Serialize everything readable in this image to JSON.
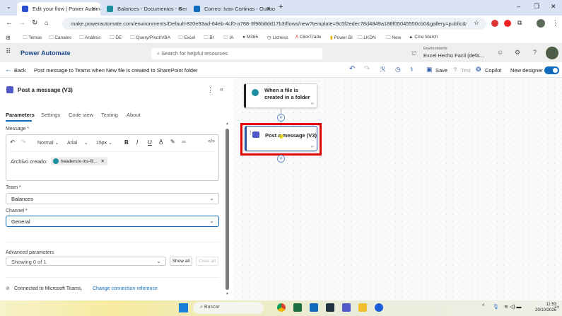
{
  "browser": {
    "tabs": [
      {
        "label": "Edit your flow | Power Automat",
        "active": true,
        "color": "#2a4fd1"
      },
      {
        "label": "Balances - Documentos - Gene",
        "active": false,
        "color": "#1d8f9e"
      },
      {
        "label": "Correo: Ivan Cortinas - Outlook",
        "active": false,
        "color": "#0f6cbd"
      }
    ],
    "url": "make.powerautomate.com/environments/Default-820e93ad-64eb-4cf0-a768-3f96b8dd17b3/flows/new?template=9c5f2edec78d4849a188f05045550cb0&gallery=public&v3=...",
    "bookmarks": [
      "Temas",
      "Canales",
      "Análisis",
      "DE",
      "Query/Pivot/VBA",
      "Excel",
      "BI",
      "IA",
      "M365",
      "Lichess",
      "ClickTrade",
      "Power BI",
      "LKDN",
      "New",
      "Cine March"
    ]
  },
  "app": {
    "name": "Power Automate",
    "search_placeholder": "Search for helpful resources",
    "env_label": "Environments",
    "env_name": "Excel Hecho Facil (defa...",
    "help": "?"
  },
  "commandbar": {
    "back": "Back",
    "flow_title": "Post message to Teams when New file is created to SharePoint folder",
    "save": "Save",
    "test": "Test",
    "copilot": "Copilot",
    "new_designer": "New designer",
    "new_designer_on": true
  },
  "panel": {
    "title": "Post a message (V3)",
    "tabs": [
      "Parameters",
      "Settings",
      "Code view",
      "Testing",
      "About"
    ],
    "active_tab": "Parameters",
    "message_label": "Message *",
    "editor": {
      "style": "Normal",
      "font": "Arial",
      "size": "15px",
      "text": "Archivo creado:",
      "token": "headers/x-ms-fil..."
    },
    "team_label": "Team *",
    "team_value": "Balances",
    "channel_label": "Channel *",
    "channel_value": "General",
    "advanced_label": "Advanced parameters",
    "advanced_value": "Showing 0 of 1",
    "show_all": "Show all",
    "clear_all": "Clear all",
    "connected": "Connected to Microsoft Teams.",
    "change_connection": "Change connection reference"
  },
  "canvas": {
    "trigger": "When a file is created in a folder",
    "action": "Post a message (V3)",
    "highlight_color": "#e00000"
  },
  "taskbar": {
    "search": "Buscar",
    "time": "11:53",
    "date": "20/10/2025"
  }
}
